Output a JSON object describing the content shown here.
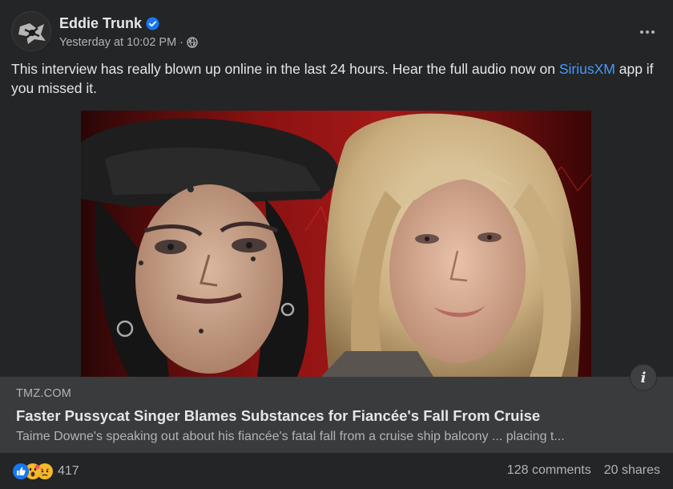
{
  "post": {
    "author": "Eddie Trunk",
    "timestamp": "Yesterday at 10:02 PM",
    "meta_separator": "·",
    "text_before_link": "This interview has really blown up online in the last 24 hours. Hear the full audio now on ",
    "link_text": "SiriusXM",
    "text_after_link": " app if you missed it.",
    "icons": {
      "verified": "verified-badge-icon",
      "audience": "globe-icon",
      "more": "more-options-icon",
      "info": "info-icon"
    }
  },
  "link_preview": {
    "domain": "TMZ.COM",
    "title": "Faster Pussycat Singer Blames Substances for Fiancée's Fall From Cruise",
    "description": "Taime Downe's speaking out about his fiancée's fatal fall from a cruise ship balcony ... placing t...",
    "info_glyph": "i"
  },
  "engagement": {
    "reaction_count": "417",
    "comments": "128 comments",
    "shares": "20 shares",
    "reaction_types": [
      "like",
      "wow",
      "sad"
    ]
  },
  "colors": {
    "background": "#242526",
    "preview_background": "#3a3b3c",
    "link": "#4599ff",
    "primary_text": "#e4e6eb",
    "secondary_text": "#b0b3b8",
    "like_blue": "#1877f2",
    "reaction_yellow": "#f7b928"
  }
}
